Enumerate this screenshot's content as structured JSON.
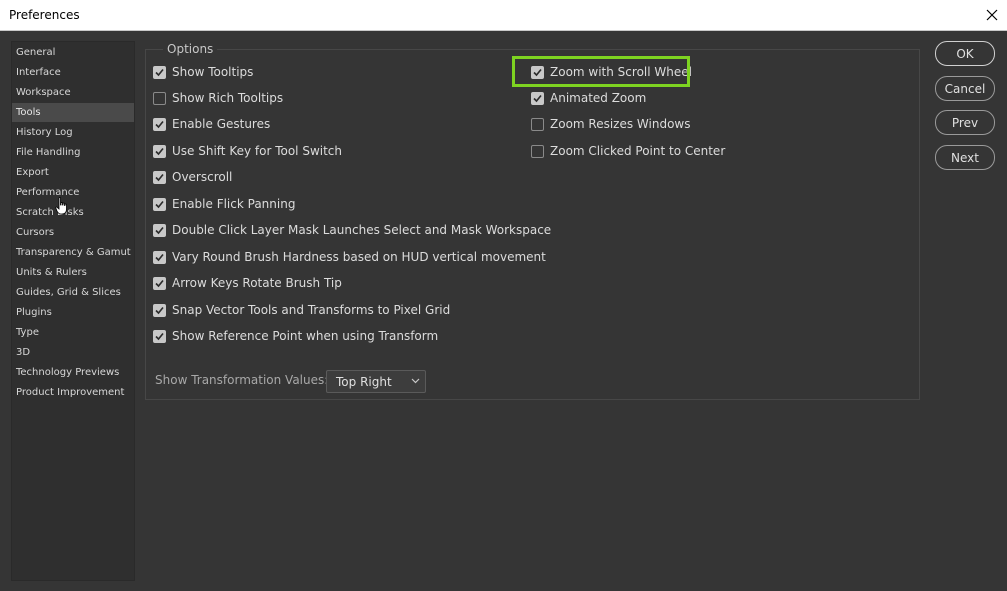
{
  "window": {
    "title": "Preferences"
  },
  "sidebar": {
    "items": [
      {
        "label": "General",
        "active": false
      },
      {
        "label": "Interface",
        "active": false
      },
      {
        "label": "Workspace",
        "active": false
      },
      {
        "label": "Tools",
        "active": true
      },
      {
        "label": "History Log",
        "active": false
      },
      {
        "label": "File Handling",
        "active": false
      },
      {
        "label": "Export",
        "active": false
      },
      {
        "label": "Performance",
        "active": false
      },
      {
        "label": "Scratch Disks",
        "active": false
      },
      {
        "label": "Cursors",
        "active": false
      },
      {
        "label": "Transparency & Gamut",
        "active": false
      },
      {
        "label": "Units & Rulers",
        "active": false
      },
      {
        "label": "Guides, Grid & Slices",
        "active": false
      },
      {
        "label": "Plugins",
        "active": false
      },
      {
        "label": "Type",
        "active": false
      },
      {
        "label": "3D",
        "active": false
      },
      {
        "label": "Technology Previews",
        "active": false
      },
      {
        "label": "Product Improvement",
        "active": false
      }
    ]
  },
  "options": {
    "group_label": "Options",
    "left": [
      {
        "label": "Show Tooltips",
        "checked": true
      },
      {
        "label": "Show Rich Tooltips",
        "checked": false
      },
      {
        "label": "Enable Gestures",
        "checked": true
      },
      {
        "label": "Use Shift Key for Tool Switch",
        "checked": true
      },
      {
        "label": "Overscroll",
        "checked": true
      },
      {
        "label": "Enable Flick Panning",
        "checked": true
      },
      {
        "label": "Double Click Layer Mask Launches Select and Mask Workspace",
        "checked": true
      },
      {
        "label": "Vary Round Brush Hardness based on HUD vertical movement",
        "checked": true
      },
      {
        "label": "Arrow Keys Rotate Brush Tip",
        "checked": true
      },
      {
        "label": "Snap Vector Tools and Transforms to Pixel Grid",
        "checked": true
      },
      {
        "label": "Show Reference Point when using Transform",
        "checked": true
      }
    ],
    "right": [
      {
        "label": "Zoom with Scroll Wheel",
        "checked": true
      },
      {
        "label": "Animated Zoom",
        "checked": true
      },
      {
        "label": "Zoom Resizes Windows",
        "checked": false
      },
      {
        "label": "Zoom Clicked Point to Center",
        "checked": false
      }
    ],
    "transform": {
      "label": "Show Transformation Values:",
      "value": "Top Right"
    }
  },
  "buttons": {
    "ok": "OK",
    "cancel": "Cancel",
    "prev": "Prev",
    "next": "Next"
  },
  "colors": {
    "highlight": "#7ed321",
    "panel_bg": "#353535",
    "active_item": "#4a4a4a"
  }
}
